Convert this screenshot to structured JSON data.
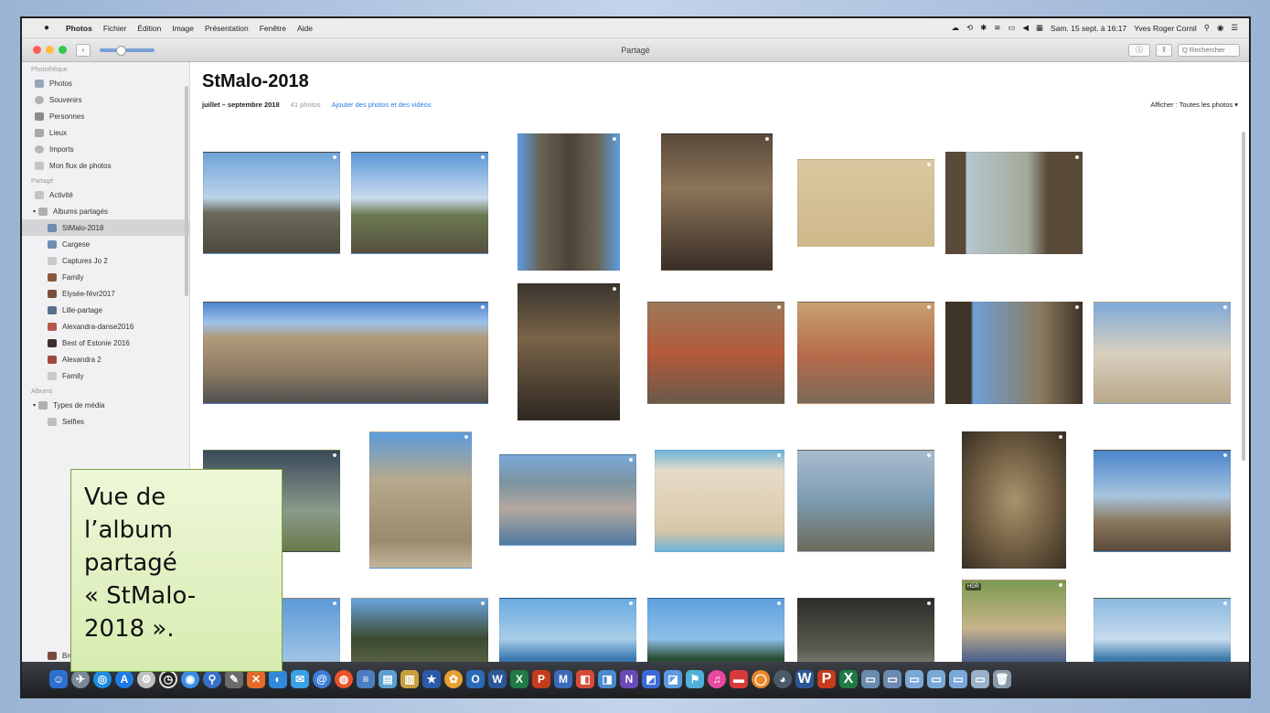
{
  "menubar": {
    "apple": "",
    "items": [
      "Photos",
      "Fichier",
      "Édition",
      "Image",
      "Présentation",
      "Fenêtre",
      "Aide"
    ],
    "clock": "Sam. 15 sept. à 16:17",
    "user": "Yves Roger Cornil"
  },
  "window": {
    "title": "Partagé",
    "search_placeholder": "Q Rechercher"
  },
  "sidebar": {
    "section_library": "Photothèque",
    "library": [
      "Photos",
      "Souvenirs",
      "Personnes",
      "Lieux",
      "Imports",
      "Mon flux de photos"
    ],
    "section_shared": "Partagé",
    "activity": "Activité",
    "shared_albums_label": "Albums partagés",
    "shared_albums": [
      "StMalo-2018",
      "Cargese",
      "Captures Jo 2",
      "Family",
      "Elysée-févr2017",
      "Lille-partage",
      "Alexandra-danse2016",
      "Best of Estonie 2016",
      "Alexandra 2",
      "Family"
    ],
    "section_albums": "Albums",
    "media_types": "Types de média",
    "media_sub": [
      "Selfies"
    ],
    "bottom_item": "Bruxelles"
  },
  "album": {
    "title": "StMalo-2018",
    "date_range": "juillet – septembre 2018",
    "count": "41 photos",
    "add_link": "Ajouter des photos et des vidéos",
    "filter": "Afficher : Toutes les photos ▾"
  },
  "callout": {
    "text": "Vue de\nl’album\npartagé\n« StMalo-\n2018 »."
  },
  "colors": {
    "selection": "#d4d4d6",
    "link": "#2a7ae2",
    "callout_bg": "#e3f2c6",
    "callout_border": "#7aa343"
  }
}
